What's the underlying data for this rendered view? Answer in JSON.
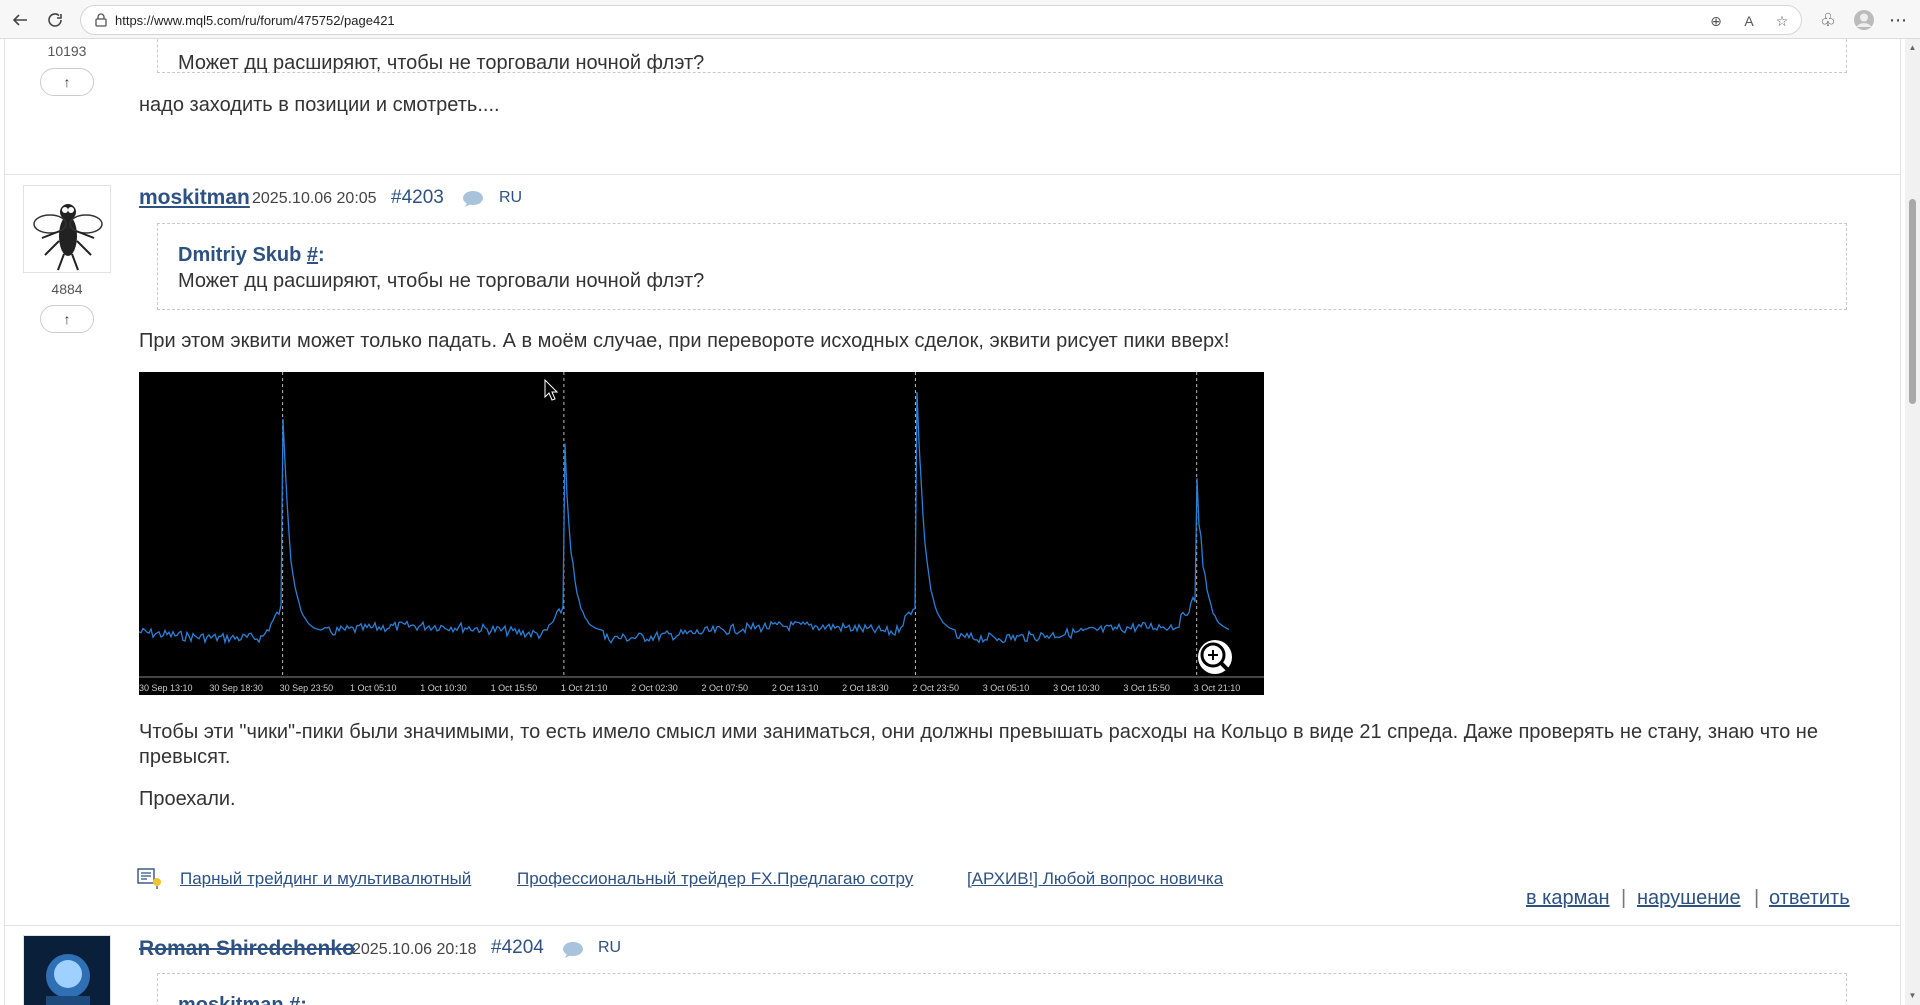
{
  "browser": {
    "url": "https://www.mql5.com/ru/forum/475752/page421"
  },
  "prev_post": {
    "rating": "10193",
    "quote_text": "Может дц расширяют, чтобы не торговали ночной флэт?",
    "reply_text": "надо заходить в позиции и смотреть...."
  },
  "post": {
    "author": "moskitman",
    "date": "2025.10.06 20:05",
    "number": "#4203",
    "lang": "RU",
    "rating": "4884",
    "quote_author": "Dmitriy Skub",
    "quote_hash": "#",
    "quote_colon": ":",
    "quote_text": "Может дц расширяют, чтобы не торговали ночной флэт?",
    "text1": "При этом эквити может только падать. А в моём случае, при перевороте исходных сделок, эквити рисует пики вверх!",
    "text2": "Чтобы эти \"чики\"-пики были значимыми, то есть имело смысл ими заниматься, они должны превышать расходы на Кольцо в виде 21 спреда. Даже проверять не стану, знаю что не превысят.",
    "text3": "Проехали.",
    "related": [
      "Парный трейдинг и мультивалютный",
      "Профессиональный трейдер FX.Предлагаю сотру",
      "[АРХИВ!] Любой вопрос новичка"
    ],
    "actions": {
      "pocket": "в карман",
      "violation": "нарушение",
      "reply": "ответить"
    }
  },
  "next_post": {
    "author": "Roman Shiredchenko",
    "date": "2025.10.06 20:18",
    "number": "#4204",
    "lang": "RU",
    "quote_author": "moskitman #:"
  },
  "chart_data": {
    "type": "line",
    "x_ticks": [
      "30 Sep 13:10",
      "30 Sep 18:30",
      "30 Sep 23:50",
      "1 Oct 05:10",
      "1 Oct 10:30",
      "1 Oct 15:50",
      "1 Oct 21:10",
      "2 Oct 02:30",
      "2 Oct 07:50",
      "2 Oct 13:10",
      "2 Oct 18:30",
      "2 Oct 23:50",
      "3 Oct 05:10",
      "3 Oct 10:30",
      "3 Oct 15:50",
      "3 Oct 21:10"
    ],
    "background": "#000000",
    "line_color": "#2a7fd6",
    "grid": false,
    "spike_ticks": [
      "30 Sep 23:50",
      "1 Oct 21:10",
      "2 Oct 23:50",
      "3 Oct 21:10"
    ]
  },
  "colors": {
    "link": "#2d5183",
    "text": "#333333"
  }
}
